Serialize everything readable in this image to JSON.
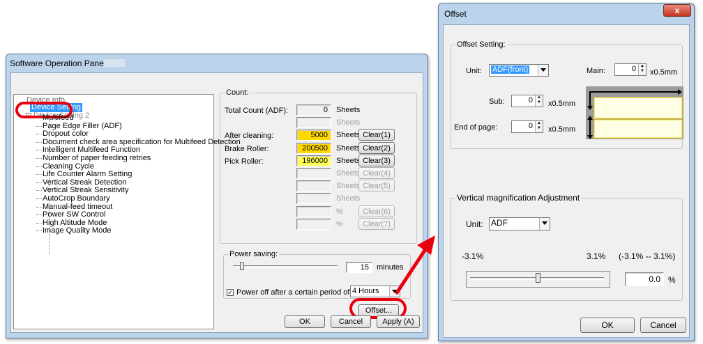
{
  "main_window": {
    "title": "Software Operation Panel fi-",
    "tree": {
      "root": "Device Setting",
      "items": [
        "Device Setting",
        "Multifeed",
        "Page Edge Filler (ADF)",
        "Dropout color",
        "Document check area specification for Multifeed Detection",
        "Intelligent Multifeed Function",
        "Number of paper feeding retries",
        "Cleaning Cycle",
        "Life Counter Alarm Setting",
        "Vertical Streak Detection",
        "Vertical Streak Sensitivity",
        "AutoCrop Boundary",
        "Manual-feed timeout",
        "Power SW Control",
        "High Altitude Mode",
        "Image Quality Mode"
      ]
    },
    "count": {
      "title": "Count:",
      "rows": [
        {
          "label": "Total Count (ADF):",
          "value": "0",
          "unit": "Sheets",
          "clear": ""
        },
        {
          "label": "",
          "value": "",
          "unit": "Sheets",
          "clear": ""
        },
        {
          "label": "After cleaning:",
          "value": "5000",
          "unit": "Sheets",
          "clear": "Clear(1)"
        },
        {
          "label": "Brake Roller:",
          "value": "200500",
          "unit": "Sheets",
          "clear": "Clear(2)"
        },
        {
          "label": "Pick Roller:",
          "value": "196000",
          "unit": "Sheets",
          "clear": "Clear(3)"
        },
        {
          "label": "",
          "value": "",
          "unit": "Sheets",
          "clear": "Clear(4)"
        },
        {
          "label": "",
          "value": "",
          "unit": "Sheets",
          "clear": "Clear(5)"
        },
        {
          "label": "",
          "value": "",
          "unit": "Sheets",
          "clear": ""
        },
        {
          "label": "",
          "value": "",
          "unit": "%",
          "clear": "Clear(6)"
        },
        {
          "label": "",
          "value": "",
          "unit": "%",
          "clear": "Clear(7)"
        }
      ]
    },
    "power": {
      "title": "Power saving:",
      "value": "15",
      "unit": "minutes",
      "checkbox_label": "Power off after a certain period of time",
      "checked": true,
      "hours": "4 Hours"
    },
    "offset_button": "Offset...",
    "ok": "OK",
    "cancel": "Cancel",
    "apply": "Apply (A)"
  },
  "offset_dialog": {
    "title": "Offset",
    "close": "x",
    "offset_setting": {
      "title": "Offset Setting:",
      "unit_label": "Unit:",
      "unit_value": "ADF(front)",
      "main_label": "Main:",
      "main_value": "0",
      "main_unit": "x0.5mm",
      "sub_label": "Sub:",
      "sub_value": "0",
      "sub_unit": "x0.5mm",
      "eop_label": "End of page:",
      "eop_value": "0",
      "eop_unit": "x0.5mm"
    },
    "vertical": {
      "title": "Vertical magnification Adjustment",
      "unit_label": "Unit:",
      "unit_value": "ADF",
      "min": "-3.1%",
      "max": "3.1%",
      "range": "(-3.1% -- 3.1%)",
      "value": "0.0",
      "pct": "%"
    },
    "ok": "OK",
    "cancel": "Cancel"
  },
  "colors": {
    "highlight": "#e8000f",
    "selected": "#3399ff",
    "yellow": "#ffd800",
    "arrow": "#e8000f"
  }
}
